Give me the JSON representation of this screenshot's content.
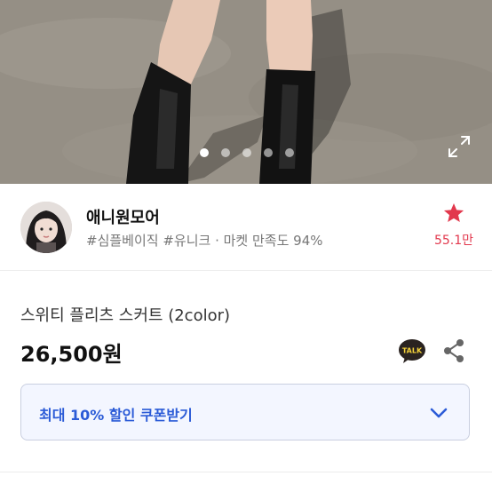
{
  "gallery": {
    "slides": 5,
    "active_index": 0,
    "expand_icon": "expand-icon"
  },
  "seller": {
    "name": "애니원모어",
    "tags": "#심플베이직 #유니크 · 마켓 만족도 94%",
    "favorite_icon": "star-icon",
    "favorite_count": "55.1만",
    "accent_color": "#e2384d"
  },
  "product": {
    "title": "스위티 플리츠 스커트 (2color)",
    "price": "26,500원",
    "talk_icon": "kakao-talk-icon",
    "talk_label": "TALK",
    "share_icon": "share-icon"
  },
  "coupon": {
    "label": "최대 10% 할인 쿠폰받기",
    "chevron_icon": "chevron-down-icon",
    "accent_color": "#2b5bd7"
  }
}
